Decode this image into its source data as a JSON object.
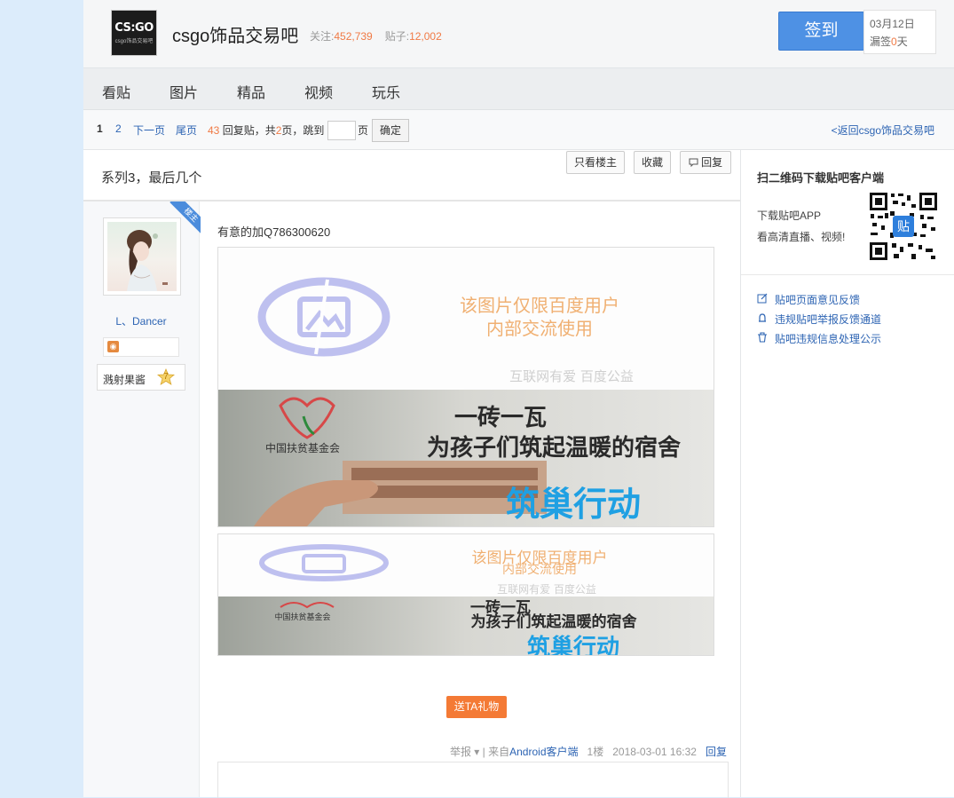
{
  "header": {
    "logo_text": "CS:GO",
    "logo_sub": "csgo饰品交易吧",
    "forum_name": "csgo饰品交易吧",
    "follow_label": "关注:",
    "follow_count": "452,739",
    "posts_label": "贴子:",
    "posts_count": "12,002",
    "signin_label": "签到",
    "date": "03月12日",
    "missed_label": "漏签",
    "missed_count": "0",
    "missed_unit": "天"
  },
  "nav": {
    "tabs": [
      "看贴",
      "图片",
      "精品",
      "视频",
      "玩乐"
    ]
  },
  "pager": {
    "current": "1",
    "page2": "2",
    "next": "下一页",
    "last": "尾页",
    "reply_count": "43",
    "reply_label": "回复贴，共",
    "total_pages": "2",
    "pages_label": "页，跳到",
    "page_unit": "页",
    "confirm": "确定",
    "back": "<返回csgo饰品交易吧"
  },
  "thread": {
    "title": "系列3，最后几个",
    "only_op": "只看楼主",
    "favorite": "收藏",
    "reply": "回复"
  },
  "author": {
    "op_tag": "楼主",
    "name": "L、Dancer",
    "badge_name": "溅射果酱",
    "level": "7"
  },
  "post": {
    "text": "有意的加Q786300620",
    "image_notice_1": "该图片仅限百度用户",
    "image_notice_2": "内部交流使用",
    "image_footer": "互联网有爱  百度公益",
    "banner_line1": "一砖一瓦",
    "banner_line2": "为孩子们筑起温暖的宿舍",
    "banner_line3": "筑巢行动",
    "foundation_name": "中国扶贫基金会",
    "gift": "送TA礼物",
    "report": "举报",
    "source_prefix": "| 来自",
    "source": "Android客户端",
    "floor": "1楼",
    "time": "2018-03-01 16:32",
    "reply": "回复"
  },
  "sidebar": {
    "title": "扫二维码下载贴吧客户端",
    "line1": "下载贴吧APP",
    "line2": "看高清直播、视频!",
    "qr_badge": "贴",
    "feedback": [
      "贴吧页面意见反馈",
      "违规贴吧举报反馈通道",
      "贴吧违规信息处理公示"
    ]
  },
  "colors": {
    "accent_blue": "#4e91e4",
    "link": "#2d64b3",
    "orange": "#f47a35",
    "page_bg": "#dcecfb"
  }
}
